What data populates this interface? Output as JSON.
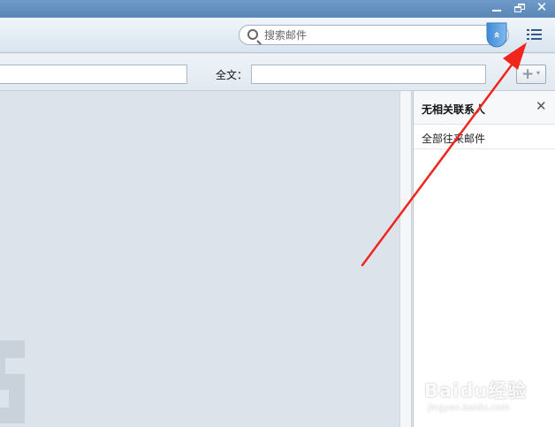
{
  "search": {
    "placeholder": "搜索邮件",
    "toggle_glyph": "«"
  },
  "filter": {
    "fulltext_label": "全文：",
    "add_glyph": "+",
    "add_caret": "▾"
  },
  "window": {
    "close_glyph": "✕"
  },
  "contact_panel": {
    "title": "无相关联系人",
    "close_glyph": "✕",
    "items": [
      {
        "label": "全部往来邮件"
      }
    ]
  },
  "watermark": {
    "logo": "Baidu经验",
    "url": "jingyan.baidu.com"
  },
  "colors": {
    "titlebar": "#5b87b8",
    "accent": "#3f8bd6",
    "arrow": "#f0261e",
    "panel_bg": "#ffffff",
    "main_bg": "#dce3ea"
  },
  "icons": {
    "search": "search-icon",
    "menu": "list-menu-icon",
    "close": "close-icon",
    "minimize": "minimize-icon",
    "restore": "restore-icon",
    "toggle": "chevrons-up-icon"
  }
}
